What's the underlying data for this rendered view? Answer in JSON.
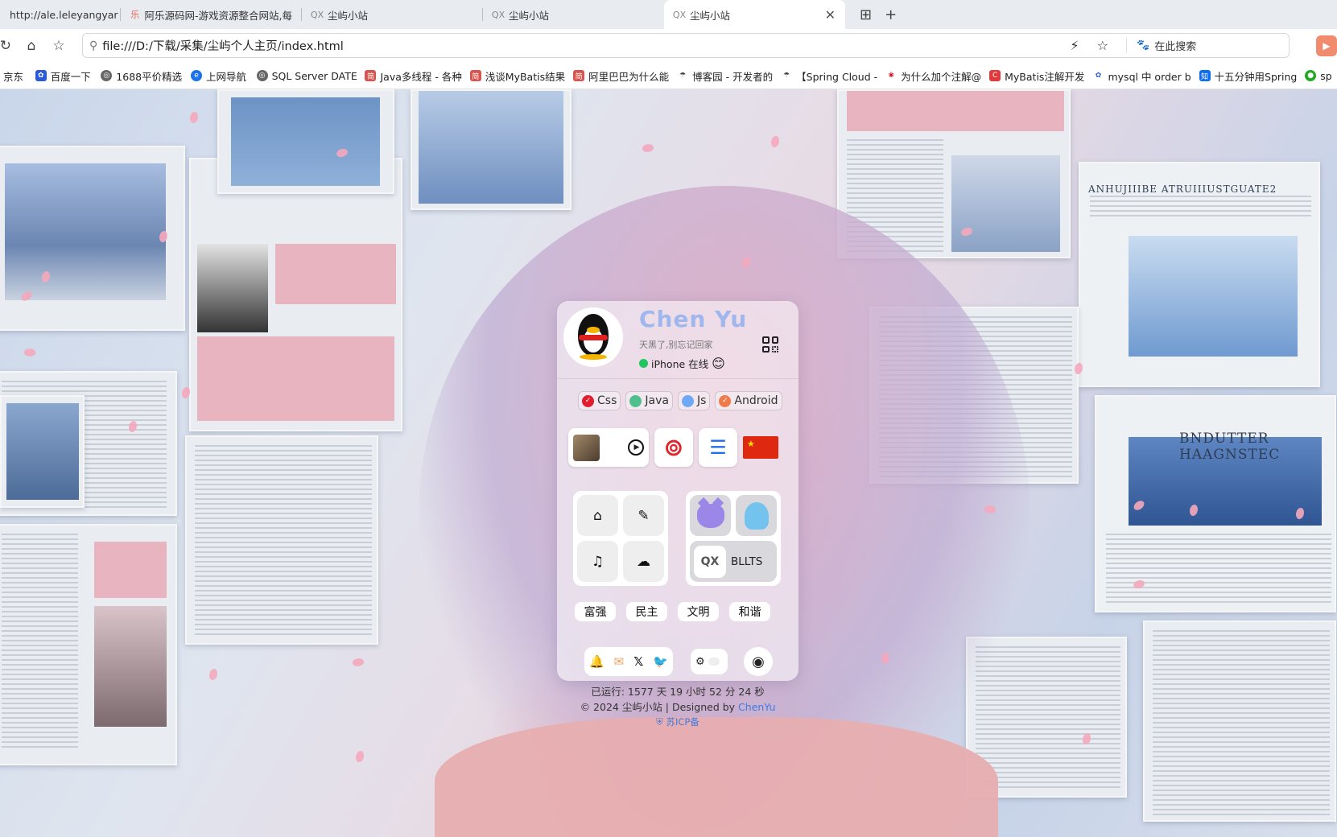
{
  "tabs": [
    {
      "label": "http://ale.leleyangyar",
      "active": false
    },
    {
      "label": "阿乐源码网-游戏资源整合网站,每",
      "active": false
    },
    {
      "label": "尘屿小站",
      "active": false
    },
    {
      "label": "尘屿小站",
      "active": false
    },
    {
      "label": "尘屿小站",
      "active": true
    }
  ],
  "address": {
    "url": "file:///D:/下载/采集/尘屿个人主页/index.html",
    "search_label": "在此搜索"
  },
  "bookmarks": [
    {
      "label": "京东",
      "color": "#e1251b"
    },
    {
      "label": "百度一下",
      "color": "#2a5bd7"
    },
    {
      "label": "1688平价精选",
      "color": "#555555"
    },
    {
      "label": "上网导航",
      "color": "#1a73e8"
    },
    {
      "label": "SQL Server DATE",
      "color": "#555555"
    },
    {
      "label": "Java多线程 - 各种",
      "color": "#d9534f"
    },
    {
      "label": "浅谈MyBatis结果",
      "color": "#d9534f"
    },
    {
      "label": "阿里巴巴为什么能",
      "color": "#d9534f"
    },
    {
      "label": "博客园 - 开发者的",
      "color": "#444444"
    },
    {
      "label": "【Spring Cloud -",
      "color": "#444444"
    },
    {
      "label": "为什么加个注解@",
      "color": "#c7000b"
    },
    {
      "label": "MyBatis注解开发",
      "color": "#e4393c"
    },
    {
      "label": "mysql 中 order b",
      "color": "#2a5bd7"
    },
    {
      "label": "十五分钟用Spring",
      "color": "#0f6ef0"
    },
    {
      "label": "sp",
      "color": "#22aa22"
    }
  ],
  "profile": {
    "name": "Chen Yu",
    "motto": "天黑了,别忘记回家",
    "status": "iPhone 在线",
    "emoji": "😊"
  },
  "skills": [
    {
      "label": "Css",
      "color": "#e11d2d"
    },
    {
      "label": "Java",
      "color": "#4fc08d"
    },
    {
      "label": "Js",
      "color": "#6fa8f5"
    },
    {
      "label": "Android",
      "color": "#f07b4a"
    }
  ],
  "quick_links": [
    "home",
    "edit",
    "music",
    "cloud"
  ],
  "projects": {
    "bllts_logo": "QX",
    "bllts_label": "BLLTS"
  },
  "values": [
    "富强",
    "民主",
    "文明",
    "和谐"
  ],
  "footer": {
    "uptime": "已运行: 1577 天 19 小时 52 分 24 秒",
    "copyright": "© 2024 尘屿小站 | Designed by ",
    "designer": "ChenYu",
    "icp": "苏ICP备"
  },
  "background_text": {
    "headline_right": "BNDUTTER HAAGNSTEC",
    "headline_top": "ANHUJIIIBE ATRUIIIUSTGUATE2"
  }
}
